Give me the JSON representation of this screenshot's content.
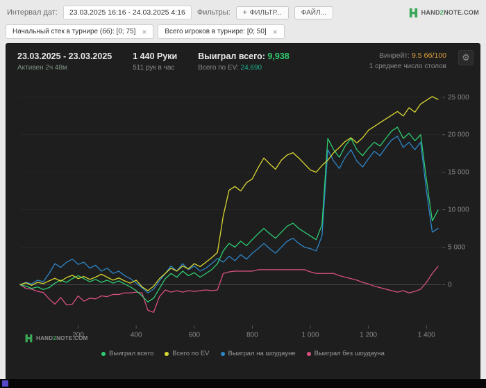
{
  "topbar": {
    "date_interval_label": "Интервал дат:",
    "date_interval_value": "23.03.2025 16:16 - 24.03.2025 4:16",
    "filters_label": "Фильтры:",
    "filter_button_plus": "+",
    "filter_button_label": "ФИЛЬТР...",
    "file_button_label": "ФАЙЛ..."
  },
  "logo": {
    "p1": "HAND",
    "p2": "2",
    "p3": "NOTE.COM"
  },
  "filter_chips": [
    {
      "label": "Начальный стек в турнире (бб): [0; 75]",
      "close": "×"
    },
    {
      "label": "Всего игроков в турнире: [0; 50]",
      "close": "×"
    }
  ],
  "panel_header": {
    "date_range": "23.03.2025 - 23.03.2025",
    "active": "Активен 2ч 48м",
    "hands": "1 440 Руки",
    "hands_per_hour": "511 рук в час",
    "won_label": "Выиграл всего:",
    "won_value": "9,938",
    "ev_label": "Всего по EV:",
    "ev_value": "24,690",
    "winrate_label": "Винрейт:",
    "winrate_value": "9.5 бб/100",
    "avg_tables": "1 среднее число столов",
    "settings_icon": "⚙"
  },
  "colors": {
    "won_green": "#2ecc71",
    "ev_teal": "#1fae8e",
    "winrate_orange": "#dca03c",
    "brand_green": "#3aa857"
  },
  "chart_data": {
    "type": "line",
    "title": "",
    "xlabel": "",
    "ylabel": "",
    "xlim": [
      0,
      1450
    ],
    "ylim": [
      -5300,
      26700
    ],
    "grid": "horizontal-subtle",
    "zero_line": true,
    "legend_position": "bottom",
    "x_start": 0,
    "x_step": 20,
    "xticks": [
      {
        "v": 200,
        "label": "200"
      },
      {
        "v": 400,
        "label": "400"
      },
      {
        "v": 600,
        "label": "600"
      },
      {
        "v": 800,
        "label": "800"
      },
      {
        "v": 1000,
        "label": "1 000"
      },
      {
        "v": 1200,
        "label": "1 200"
      },
      {
        "v": 1400,
        "label": "1 400"
      }
    ],
    "yticks": [
      {
        "v": 0,
        "label": "0"
      },
      {
        "v": 5000,
        "label": "5 000"
      },
      {
        "v": 10000,
        "label": "10 000"
      },
      {
        "v": 15000,
        "label": "15 000"
      },
      {
        "v": 20000,
        "label": "20 000"
      },
      {
        "v": 25000,
        "label": "25 000"
      }
    ],
    "series": [
      {
        "name": "Выиграл всего",
        "color": "#2ecc71",
        "final_value": 9938,
        "values": [
          0,
          -200,
          -500,
          -300,
          -650,
          -400,
          200,
          600,
          300,
          800,
          1200,
          800,
          400,
          700,
          300,
          600,
          200,
          500,
          100,
          -300,
          -800,
          -1500,
          -2300,
          -1800,
          -500,
          800,
          1500,
          1000,
          1800,
          1200,
          1600,
          1000,
          1500,
          2000,
          2800,
          4500,
          5500,
          5000,
          5800,
          5200,
          6000,
          6800,
          7500,
          6800,
          6200,
          7000,
          7800,
          8200,
          7500,
          7000,
          6500,
          6000,
          8000,
          19500,
          18000,
          17000,
          18500,
          19500,
          18000,
          17200,
          18200,
          19000,
          18500,
          19500,
          20500,
          21000,
          19500,
          20200,
          19200,
          20000,
          14000,
          8500,
          9938
        ]
      },
      {
        "name": "Всего по EV",
        "color": "#d9d832",
        "final_value": 24690,
        "values": [
          0,
          250,
          -100,
          300,
          150,
          500,
          850,
          450,
          950,
          1250,
          800,
          1100,
          700,
          1000,
          1400,
          1000,
          600,
          900,
          500,
          200,
          600,
          -300,
          -800,
          -200,
          800,
          1500,
          2200,
          1800,
          2500,
          2100,
          2800,
          2400,
          3000,
          3600,
          4300,
          9200,
          12600,
          13100,
          12500,
          13600,
          14100,
          15600,
          16900,
          16100,
          15400,
          16600,
          17300,
          17600,
          16900,
          16100,
          15300,
          15000,
          15900,
          16600,
          17600,
          18300,
          19100,
          19600,
          18900,
          19600,
          20600,
          21100,
          21600,
          22100,
          22600,
          23100,
          22500,
          23600,
          23000,
          24100,
          24600,
          25100,
          24690
        ]
      },
      {
        "name": "Выиграл на шоудауне",
        "color": "#2e86c8",
        "final_value": 7500,
        "values": [
          0,
          300,
          100,
          600,
          400,
          1500,
          2800,
          2300,
          3000,
          3400,
          2700,
          3000,
          2200,
          2600,
          1800,
          2200,
          1500,
          1800,
          1200,
          800,
          200,
          -400,
          -1100,
          -600,
          500,
          1500,
          2500,
          1800,
          2800,
          2000,
          2500,
          1800,
          2200,
          2800,
          3500,
          3000,
          3800,
          3200,
          4000,
          3400,
          4200,
          4800,
          5500,
          4800,
          4200,
          5000,
          5800,
          6200,
          5500,
          5000,
          4800,
          4500,
          6500,
          18000,
          16500,
          15500,
          17000,
          18000,
          16500,
          15700,
          16800,
          17800,
          17200,
          18300,
          19300,
          19800,
          18300,
          19000,
          18000,
          19000,
          12500,
          7000,
          7500
        ]
      },
      {
        "name": "Выиграл без шоудауна",
        "color": "#d85080",
        "final_value": 2438,
        "values": [
          0,
          -500,
          -600,
          -900,
          -1050,
          -1900,
          -2600,
          -1700,
          -2700,
          -2600,
          -1500,
          -2200,
          -1800,
          -1900,
          -1500,
          -1600,
          -1300,
          -1300,
          -1100,
          -1100,
          -1000,
          -1100,
          -3400,
          -3700,
          -1600,
          -700,
          -1000,
          -800,
          -1000,
          -800,
          -900,
          -800,
          -700,
          -800,
          -700,
          1500,
          1700,
          1800,
          1800,
          1800,
          1800,
          2000,
          2000,
          2000,
          2000,
          2000,
          2000,
          2000,
          2000,
          2000,
          1700,
          1500,
          1500,
          1500,
          1500,
          1200,
          1000,
          800,
          600,
          300,
          100,
          -200,
          -400,
          -600,
          -800,
          -1000,
          -800,
          -1100,
          -900,
          -600,
          300,
          1500,
          2438
        ]
      }
    ]
  }
}
